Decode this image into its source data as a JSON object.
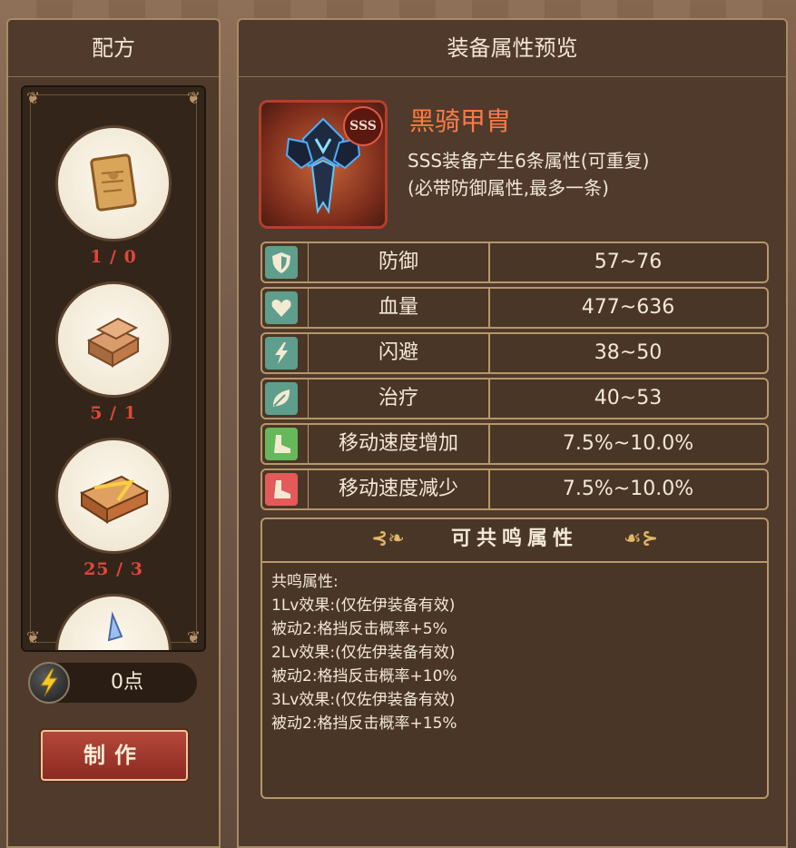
{
  "left": {
    "title": "配方",
    "recipes": [
      {
        "count": "1 / 0",
        "icon": "scroll-icon"
      },
      {
        "count": "5 / 1",
        "icon": "iron-ingot-icon"
      },
      {
        "count": "25 / 3",
        "icon": "gold-bar-icon"
      },
      {
        "count": "",
        "icon": "crystal-icon"
      }
    ],
    "points": "0点",
    "make_button": "制作"
  },
  "right": {
    "title": "装备属性预览",
    "item": {
      "name": "黑骑甲胄",
      "rarity": "SSS",
      "desc_line1": "SSS装备产生6条属性(可重复)",
      "desc_line2": "(必带防御属性,最多一条)"
    },
    "attributes": [
      {
        "name": "防御",
        "value": "57~76",
        "icon": "shield-icon",
        "color": "#5f9e8c"
      },
      {
        "name": "血量",
        "value": "477~636",
        "icon": "heart-icon",
        "color": "#5f9e8c"
      },
      {
        "name": "闪避",
        "value": "38~50",
        "icon": "lightning-icon",
        "color": "#5f9e8c"
      },
      {
        "name": "治疗",
        "value": "40~53",
        "icon": "leaf-icon",
        "color": "#5f9e8c"
      },
      {
        "name": "移动速度增加",
        "value": "7.5%~10.0%",
        "icon": "boot-up-icon",
        "color": "#66b85a"
      },
      {
        "name": "移动速度减少",
        "value": "7.5%~10.0%",
        "icon": "boot-down-icon",
        "color": "#e25a5a"
      }
    ],
    "resonance": {
      "header": "可共鸣属性",
      "lines": [
        "共鸣属性:",
        "1Lv效果:(仅佐伊装备有效)",
        "被动2:格挡反击概率+5%",
        "2Lv效果:(仅佐伊装备有效)",
        "被动2:格挡反击概率+10%",
        "3Lv效果:(仅佐伊装备有效)",
        "被动2:格挡反击概率+15%"
      ]
    }
  }
}
